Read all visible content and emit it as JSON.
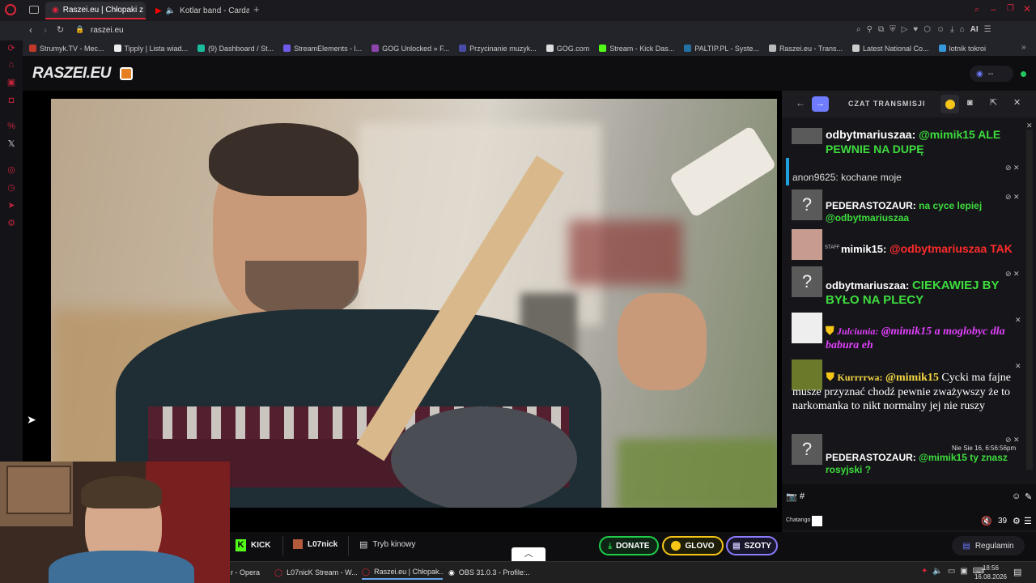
{
  "browser": {
    "tabs": [
      {
        "label": "Raszei.eu | Chłopaki z B"
      },
      {
        "label": "Kotlar band - Cardas M"
      }
    ],
    "url": "raszei.eu",
    "bookmarks": [
      {
        "label": "Strumyk.TV - Mec...",
        "color": "#c0392b"
      },
      {
        "label": "Tipply | Lista wiad...",
        "color": "#eeeeee"
      },
      {
        "label": "(9) Dashboard / St...",
        "color": "#1abc9c"
      },
      {
        "label": "StreamElements - l...",
        "color": "#6c5ce7"
      },
      {
        "label": "GOG Unlocked » F...",
        "color": "#8e44ad"
      },
      {
        "label": "Przycinanie muzyk...",
        "color": "#4a4aa8"
      },
      {
        "label": "GOG.com",
        "color": "#dddddd"
      },
      {
        "label": "Stream - Kick Das...",
        "color": "#53fc18"
      },
      {
        "label": "PALTIP.PL - Syste...",
        "color": "#2471a3"
      },
      {
        "label": "Raszei.eu - Trans...",
        "color": "#bbbbbb"
      },
      {
        "label": "Latest National Co...",
        "color": "#cccccc"
      },
      {
        "label": "lotnik tokroi",
        "color": "#3498db"
      }
    ],
    "ai_label": "AI"
  },
  "site": {
    "logo": "RASZEI.EU",
    "viewer_count": "--"
  },
  "chat": {
    "title": "CZAT TRANSMISJI",
    "messages": [
      {
        "user": "odbytmariuszaa:",
        "text": "@mimik15 ALE PEWNIE NA DUPĘ",
        "user_color": "#ffffff",
        "text_color": "#3ddc3d"
      },
      {
        "user": "anon9625:",
        "text": "kochane moje",
        "user_color": "#ffffff",
        "text_color": "#ffffff"
      },
      {
        "user": "PEDERASTOZAUR:",
        "text": "na cyce lepiej @odbytmariuszaa",
        "user_color": "#ffffff",
        "text_color": "#3ddc3d"
      },
      {
        "badge": "STAFF",
        "user": "mimik15:",
        "text": "@odbytmariuszaa TAK",
        "user_color": "#ffffff",
        "text_color": "#ff2b2b"
      },
      {
        "user": "odbytmariuszaa:",
        "text": "CIEKAWIEJ BY BYŁO NA PLECY",
        "user_color": "#ffffff",
        "text_color": "#3ddc3d"
      },
      {
        "user": "Julciunia:",
        "text": "@mimik15 a moglobyc dla babura eh",
        "user_color": "#e040fb",
        "text_color": "#e040fb"
      },
      {
        "user": "Kurrrrwa:",
        "mention": "@mimik15",
        "text": "Cycki ma fajne musze przyznać chodź pewnie zważywszy że to narkomanka to nikt normalny jej nie ruszy",
        "user_color": "#f5d742",
        "text_color": "#ffffff"
      },
      {
        "user": "PEDERASTOZAUR:",
        "text": "@mimik15 ty znasz rosyjski ?",
        "user_color": "#ffffff",
        "text_color": "#3ddc3d",
        "timestamp": "Nie Sie 16, 6:56:56pm"
      }
    ],
    "input_prefix": "#",
    "user_label": "Chatango",
    "viewer_number": "39"
  },
  "bottom": {
    "kick": "KICK",
    "channel": "L07nick",
    "cinema": "Tryb kinowy",
    "donate": "DONATE",
    "glovo": "GLOVO",
    "szoty": "SZOTY",
    "rules": "Regulamin"
  },
  "taskbar": {
    "items": [
      {
        "label": "r - Opera"
      },
      {
        "label": "L07nicK Stream - W..."
      },
      {
        "label": "Raszei.eu | Chłopak..."
      },
      {
        "label": "OBS 31.0.3 - Profile:..."
      }
    ],
    "time": "18:56",
    "date": "16.08.2026"
  }
}
